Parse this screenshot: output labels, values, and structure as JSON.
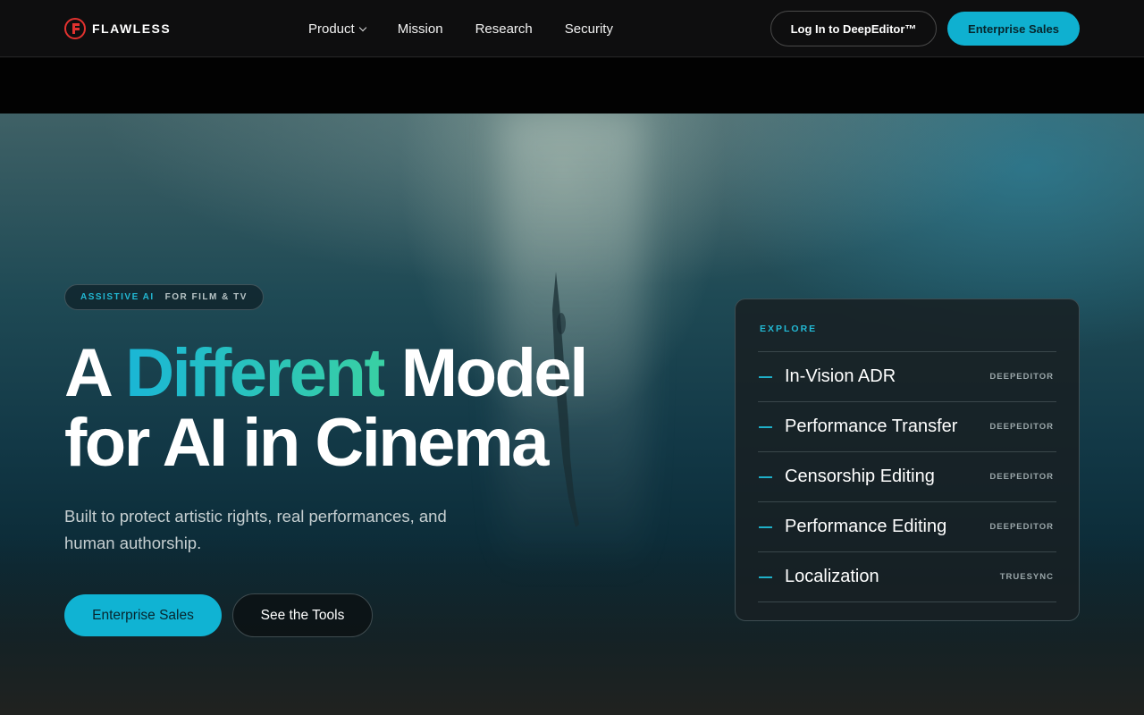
{
  "brand": {
    "name": "FLAWLESS",
    "logo_icon": "flawless-logo-icon",
    "logo_color": "#e2322f"
  },
  "nav": {
    "links": [
      {
        "label": "Product",
        "has_dropdown": true
      },
      {
        "label": "Mission"
      },
      {
        "label": "Research"
      },
      {
        "label": "Security"
      }
    ],
    "login_label": "Log In to DeepEditor™",
    "enterprise_label": "Enterprise Sales"
  },
  "hero": {
    "badge_primary": "ASSISTIVE AI",
    "badge_secondary": "FOR FILM & TV",
    "headline_part1": "A ",
    "headline_accent": "Different",
    "headline_part2": " Model",
    "headline_line2": "for AI in Cinema",
    "subtitle": "Built to protect artistic rights, real performances, and human authorship.",
    "cta_primary": "Enterprise Sales",
    "cta_secondary": "See the Tools"
  },
  "explore": {
    "title": "EXPLORE",
    "items": [
      {
        "label": "In-Vision ADR",
        "tag": "DEEPEDITOR"
      },
      {
        "label": "Performance Transfer",
        "tag": "DEEPEDITOR"
      },
      {
        "label": "Censorship Editing",
        "tag": "DEEPEDITOR"
      },
      {
        "label": "Performance Editing",
        "tag": "DEEPEDITOR"
      },
      {
        "label": "Localization",
        "tag": "TRUESYNC"
      }
    ]
  },
  "colors": {
    "accent": "#10b3d3",
    "accent_gradient_end": "#39d0a3",
    "nav_bg": "#0e0e0f"
  }
}
